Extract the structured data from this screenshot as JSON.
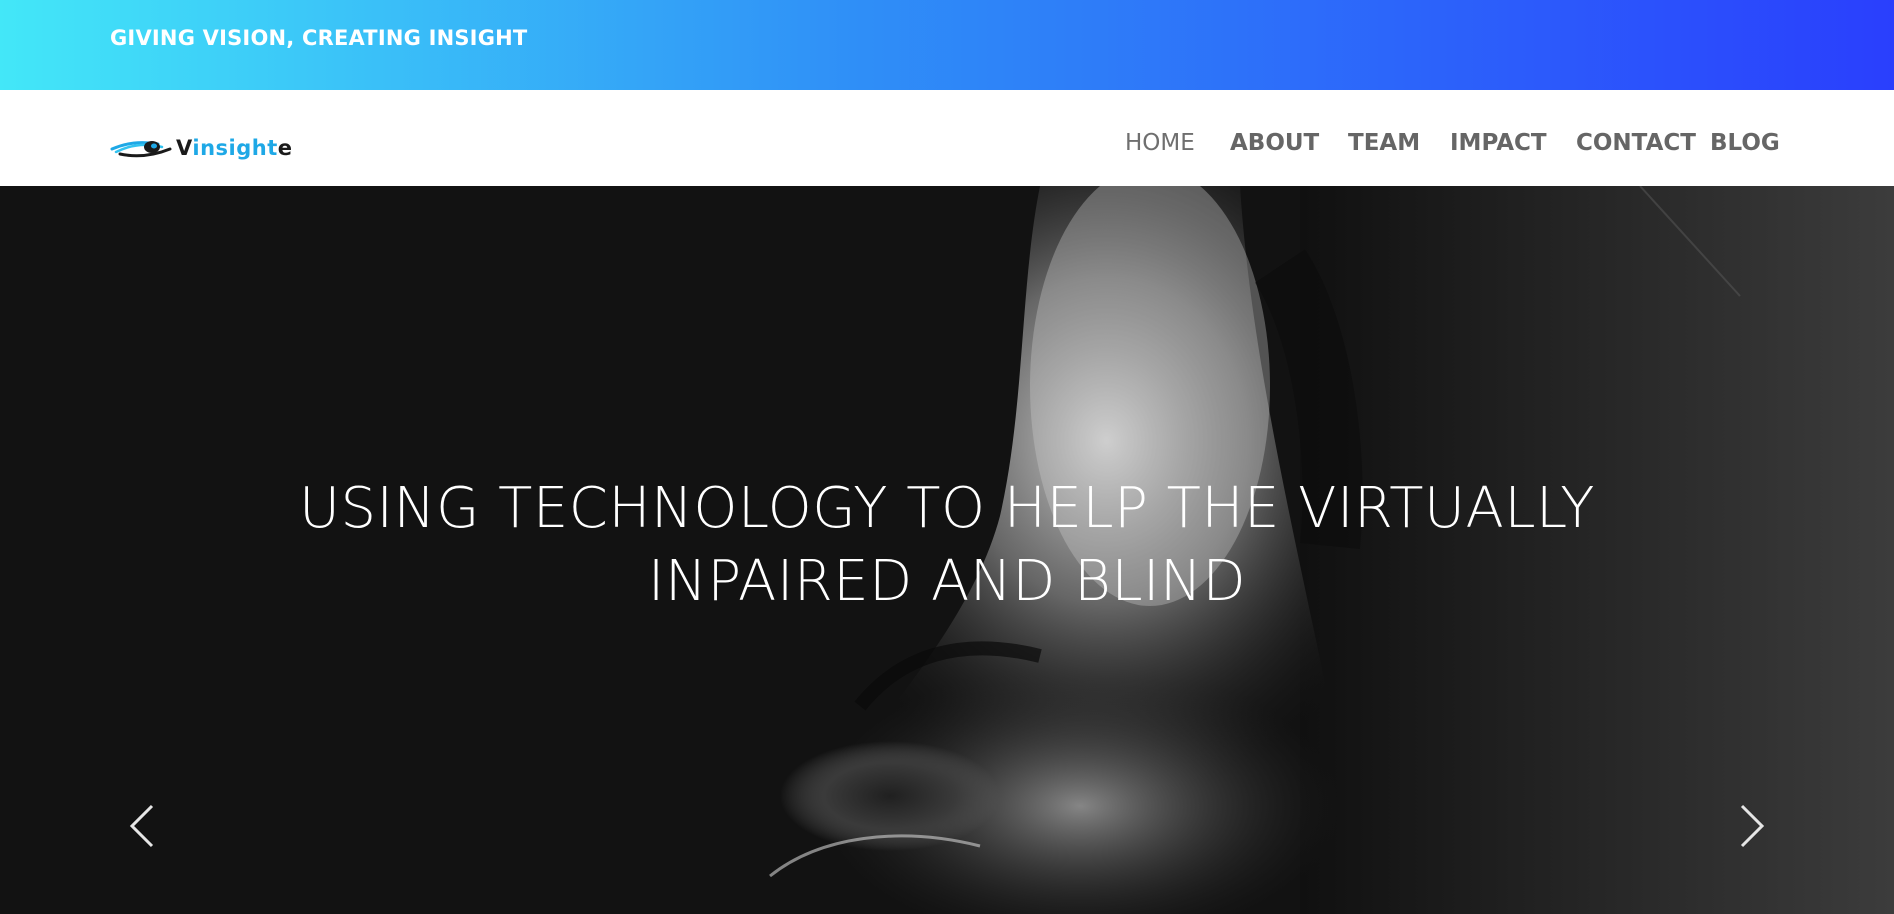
{
  "topbar": {
    "tagline": "GIVING VISION, CREATING INSIGHT",
    "gradient_start": "#43e7f8",
    "gradient_end": "#2a3ffd"
  },
  "logo": {
    "icon": "eye-logo-icon",
    "text_v": "V",
    "text_insigh": "insigh",
    "text_t": "t",
    "text_e": "e",
    "colors": {
      "dark": "#1a1a1a",
      "blue": "#1ea8e6"
    }
  },
  "nav": {
    "items": [
      {
        "label": "HOME",
        "active": true
      },
      {
        "label": "ABOUT"
      },
      {
        "label": "TEAM"
      },
      {
        "label": "IMPACT"
      },
      {
        "label": "CONTACT"
      },
      {
        "label": "BLOG"
      }
    ]
  },
  "hero": {
    "title_line1": "USING TECHNOLOGY TO HELP THE VIRTUALLY",
    "title_line2": "INPAIRED AND BLIND",
    "prev_icon": "chevron-left-icon",
    "next_icon": "chevron-right-icon"
  }
}
